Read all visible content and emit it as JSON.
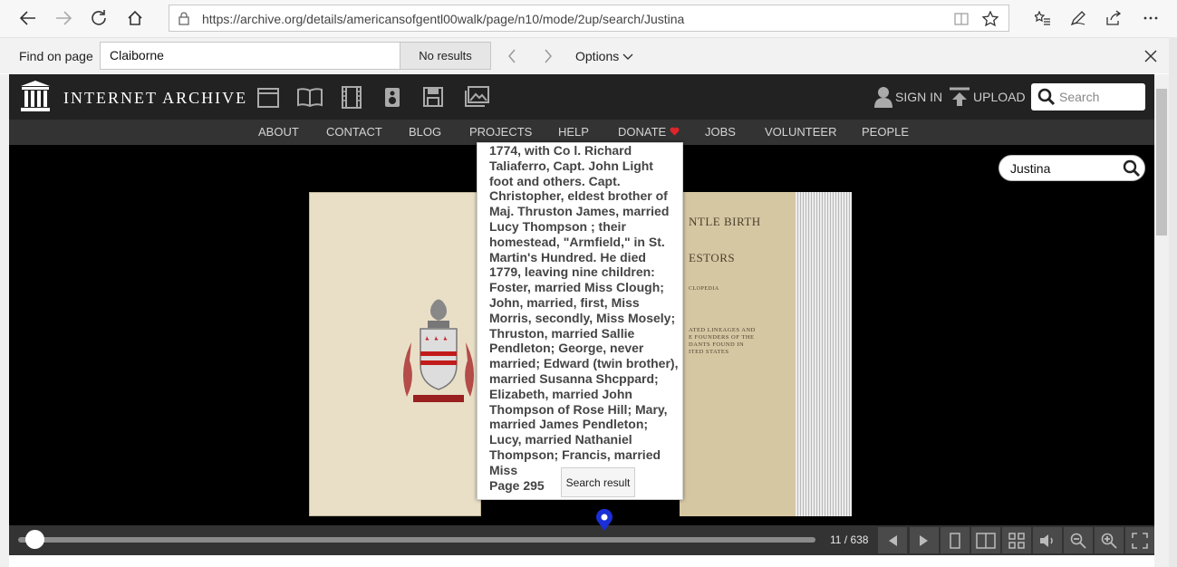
{
  "browser": {
    "url": "https://archive.org/details/americansofgentl00walk/page/n10/mode/2up/search/Justina"
  },
  "find_bar": {
    "label": "Find on page",
    "query": "Claiborne",
    "results": "No results",
    "options_label": "Options"
  },
  "ia_header": {
    "brand": "INTERNET ARCHIVE",
    "sign_in": "SIGN IN",
    "upload": "UPLOAD",
    "search_placeholder": "Search"
  },
  "subnav": [
    "ABOUT",
    "CONTACT",
    "BLOG",
    "PROJECTS",
    "HELP",
    "DONATE",
    "JOBS",
    "VOLUNTEER",
    "PEOPLE"
  ],
  "book_search": {
    "query": "Justina"
  },
  "book_page": {
    "line1": "NTLE BIRTH",
    "line2": "ESTORS",
    "line3": "CLOPEDIA",
    "line4": "ATED LINEAGES AND",
    "line5": "E FOUNDERS OF THE",
    "line6": "DANTS FOUND IN",
    "line7": "ITED STATES"
  },
  "popup": {
    "text": "1774, with Co l. Richard Taliaferro, Capt. John Light foot and others. Capt. Christopher, eldest brother of Maj. Thruston James, married Lucy Thompson ; their homestead, \"Armfield,\" in St. Martin's Hundred. He died 1779, leaving nine children: Foster, married Miss Clough; John, married, first, Miss Morris, secondly, Miss Mosely; Thruston, married Sallie Pendleton; George, never married; Edward (twin brother), married Susanna Shcppard; Elizabeth, married John Thompson of Rose Hill; Mary, married James Pendleton; Lucy, married Nathaniel Thompson; Francis, married Miss",
    "page": "Page 295",
    "tooltip": "Search result"
  },
  "navbar": {
    "page_count": "11 / 638",
    "progress_fraction": 0.017
  },
  "colors": {
    "donate_heart": "#e0242b",
    "marker": "#1a2fd6",
    "header_bg": "#222222",
    "subnav_bg": "#333333"
  }
}
